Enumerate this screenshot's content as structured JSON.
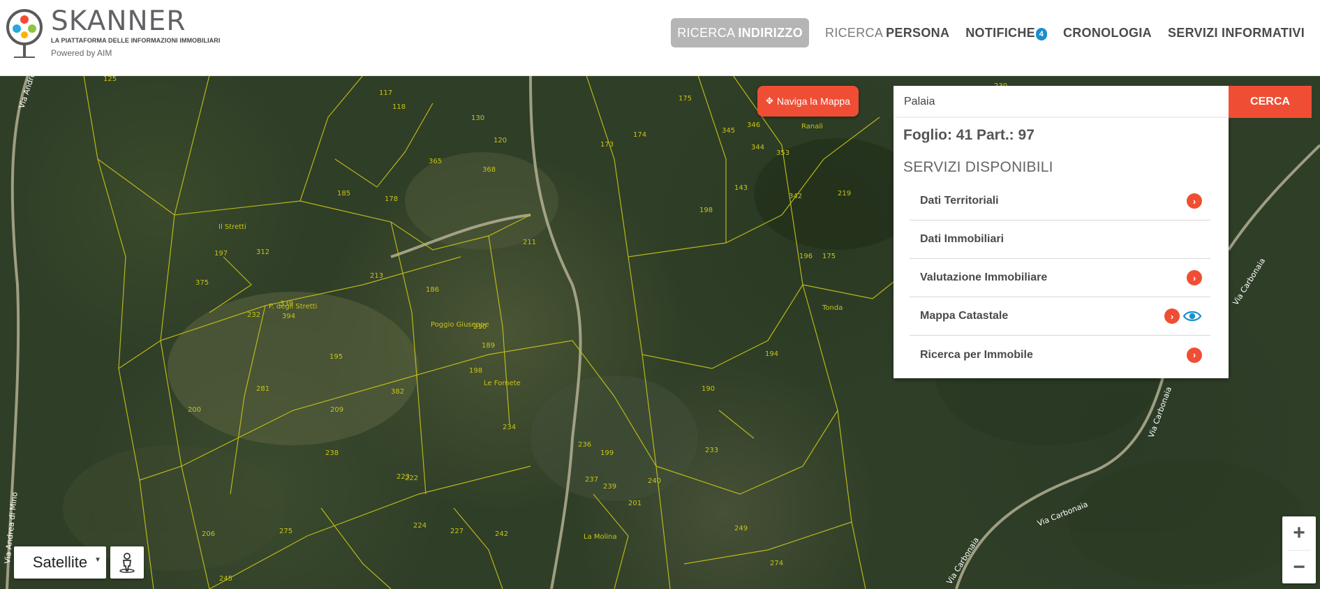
{
  "header": {
    "brand_name": "SKANNER",
    "brand_tagline": "LA PIATTAFORMA DELLE INFORMAZIONI IMMOBILIARI",
    "brand_powered": "Powered by AIM",
    "nav": [
      {
        "light": "RICERCA",
        "bold": "INDIRIZZO",
        "active": true
      },
      {
        "light": "RICERCA",
        "bold": "PERSONA"
      },
      {
        "bold": "NOTIFICHE",
        "badge": "4"
      },
      {
        "bold": "CRONOLOGIA"
      },
      {
        "bold": "SERVIZI INFORMATIVI"
      }
    ]
  },
  "map": {
    "naviga_label": "Naviga la Mappa",
    "parcel_numbers": [
      "125",
      "117",
      "118",
      "175",
      "345",
      "346",
      "230",
      "130",
      "120",
      "174",
      "344",
      "353",
      "365",
      "173",
      "143",
      "342",
      "219",
      "368",
      "185",
      "178",
      "198",
      "211",
      "196",
      "197",
      "312",
      "213",
      "186",
      "375",
      "175",
      "189",
      "210",
      "394",
      "190",
      "339",
      "232",
      "194",
      "233",
      "195",
      "281",
      "198",
      "200",
      "209",
      "382",
      "234",
      "236",
      "199",
      "238",
      "237",
      "239",
      "240",
      "201",
      "206",
      "222",
      "223",
      "224",
      "227",
      "242",
      "249",
      "274",
      "245",
      "275"
    ],
    "place_labels": [
      "Il Stretti",
      "P. degli Stretti",
      "Poggio Giuseppe",
      "Le Fornete",
      "Ranali",
      "Tonda",
      "La Molina"
    ],
    "road_labels": [
      "Via Andrea di Mino",
      "Via Andrea di Mino",
      "Via Carbonaia",
      "Via Carbonaia",
      "Via Carbonaia",
      "Via Carbonaia"
    ]
  },
  "search": {
    "value": "Palaia",
    "button": "CERCA"
  },
  "results": {
    "title": "Foglio: 41 Part.: 97",
    "subtitle": "SERVIZI DISPONIBILI",
    "services": [
      {
        "label": "Dati Territoriali",
        "go": true,
        "eye": false
      },
      {
        "label": "Dati Immobiliari",
        "go": false,
        "eye": false
      },
      {
        "label": "Valutazione Immobiliare",
        "go": true,
        "eye": false
      },
      {
        "label": "Mappa Catastale",
        "go": true,
        "eye": true
      },
      {
        "label": "Ricerca per Immobile",
        "go": true,
        "eye": false
      }
    ]
  },
  "controls": {
    "map_type": "Satellite",
    "zoom_in": "+",
    "zoom_out": "−"
  },
  "colors": {
    "accent": "#f04e34",
    "badge": "#1a8fd0",
    "parcel_lines": "#c8c418"
  }
}
